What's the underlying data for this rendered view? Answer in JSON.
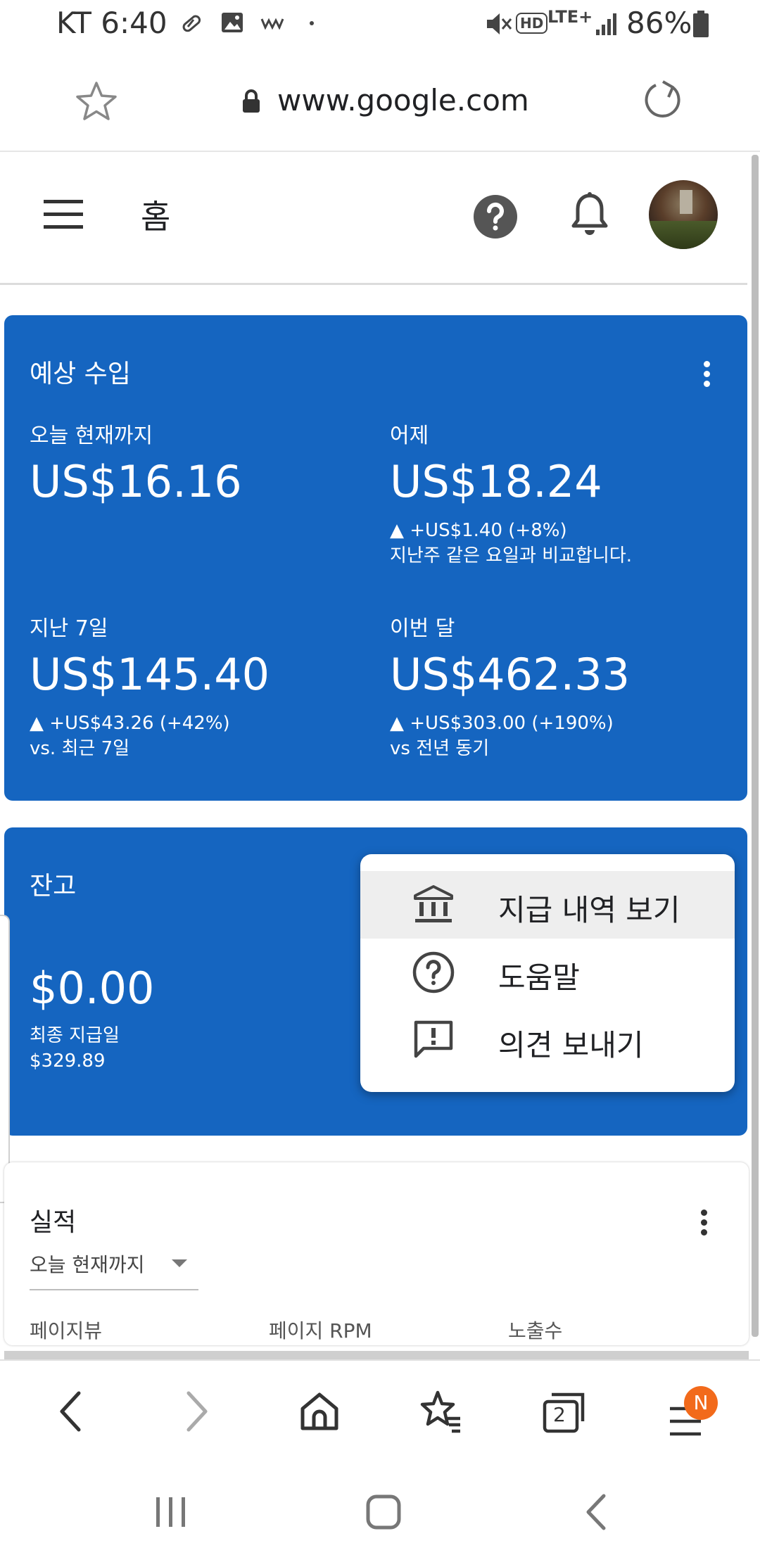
{
  "status_bar": {
    "carrier_time": "KT 6:40",
    "battery": "86%",
    "network": "LTE+",
    "hd": "HD"
  },
  "browser": {
    "url": "www.google.com"
  },
  "app_header": {
    "title": "홈"
  },
  "estimated_earnings": {
    "title": "예상 수입",
    "today": {
      "label": "오늘 현재까지",
      "value": "US$16.16"
    },
    "yesterday": {
      "label": "어제",
      "value": "US$18.24",
      "change": "▲ +US$1.40 (+8%)",
      "note": "지난주 같은 요일과 비교합니다."
    },
    "last7": {
      "label": "지난 7일",
      "value": "US$145.40",
      "change": "▲ +US$43.26 (+42%)",
      "note": "vs. 최근 7일"
    },
    "this_month": {
      "label": "이번 달",
      "value": "US$462.33",
      "change": "▲ +US$303.00 (+190%)",
      "note": "vs 전년 동기"
    }
  },
  "balance": {
    "title": "잔고",
    "value": "$0.00",
    "last_payment_label": "최종 지급일",
    "last_payment_value": "$329.89"
  },
  "context_menu": {
    "items": [
      {
        "label": "지급 내역 보기",
        "icon": "bank-icon"
      },
      {
        "label": "도움말",
        "icon": "help-outline-icon"
      },
      {
        "label": "의견 보내기",
        "icon": "feedback-icon"
      }
    ]
  },
  "performance": {
    "title": "실적",
    "range": "오늘 현재까지",
    "columns": [
      "페이지뷰",
      "페이지 RPM",
      "노출수"
    ]
  },
  "bottom_nav": {
    "tabs_count": "2",
    "menu_badge": "N"
  },
  "colors": {
    "card_blue": "#1565c0",
    "badge_orange": "#f26a1b"
  }
}
